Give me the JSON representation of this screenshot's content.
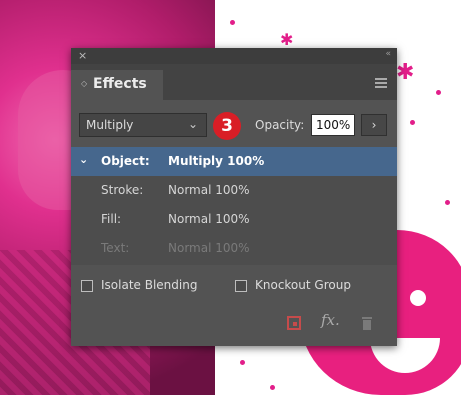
{
  "panel": {
    "title": "Effects",
    "tab_arrows": "◇",
    "close_glyph": "×",
    "collapse_glyph": "«",
    "menu_icon": "panel-menu-icon"
  },
  "controls": {
    "blend_mode": "Multiply",
    "badge_number": "3",
    "opacity_label": "Opacity:",
    "opacity_value": "100%",
    "opacity_button_glyph": "›"
  },
  "targets": [
    {
      "name": "Object:",
      "value": "Multiply 100%",
      "selected": true
    },
    {
      "name": "Stroke:",
      "value": "Normal 100%"
    },
    {
      "name": "Fill:",
      "value": "Normal 100%"
    },
    {
      "name": "Text:",
      "value": "Normal 100%",
      "disabled": true
    }
  ],
  "options": {
    "isolate_blending": "Isolate Blending",
    "knockout_group": "Knockout Group"
  },
  "footer": {
    "fx_label": "fx."
  },
  "colors": {
    "accent_selected": "#46678d",
    "badge": "#d91e26",
    "background_magenta": "#e21e8a"
  }
}
